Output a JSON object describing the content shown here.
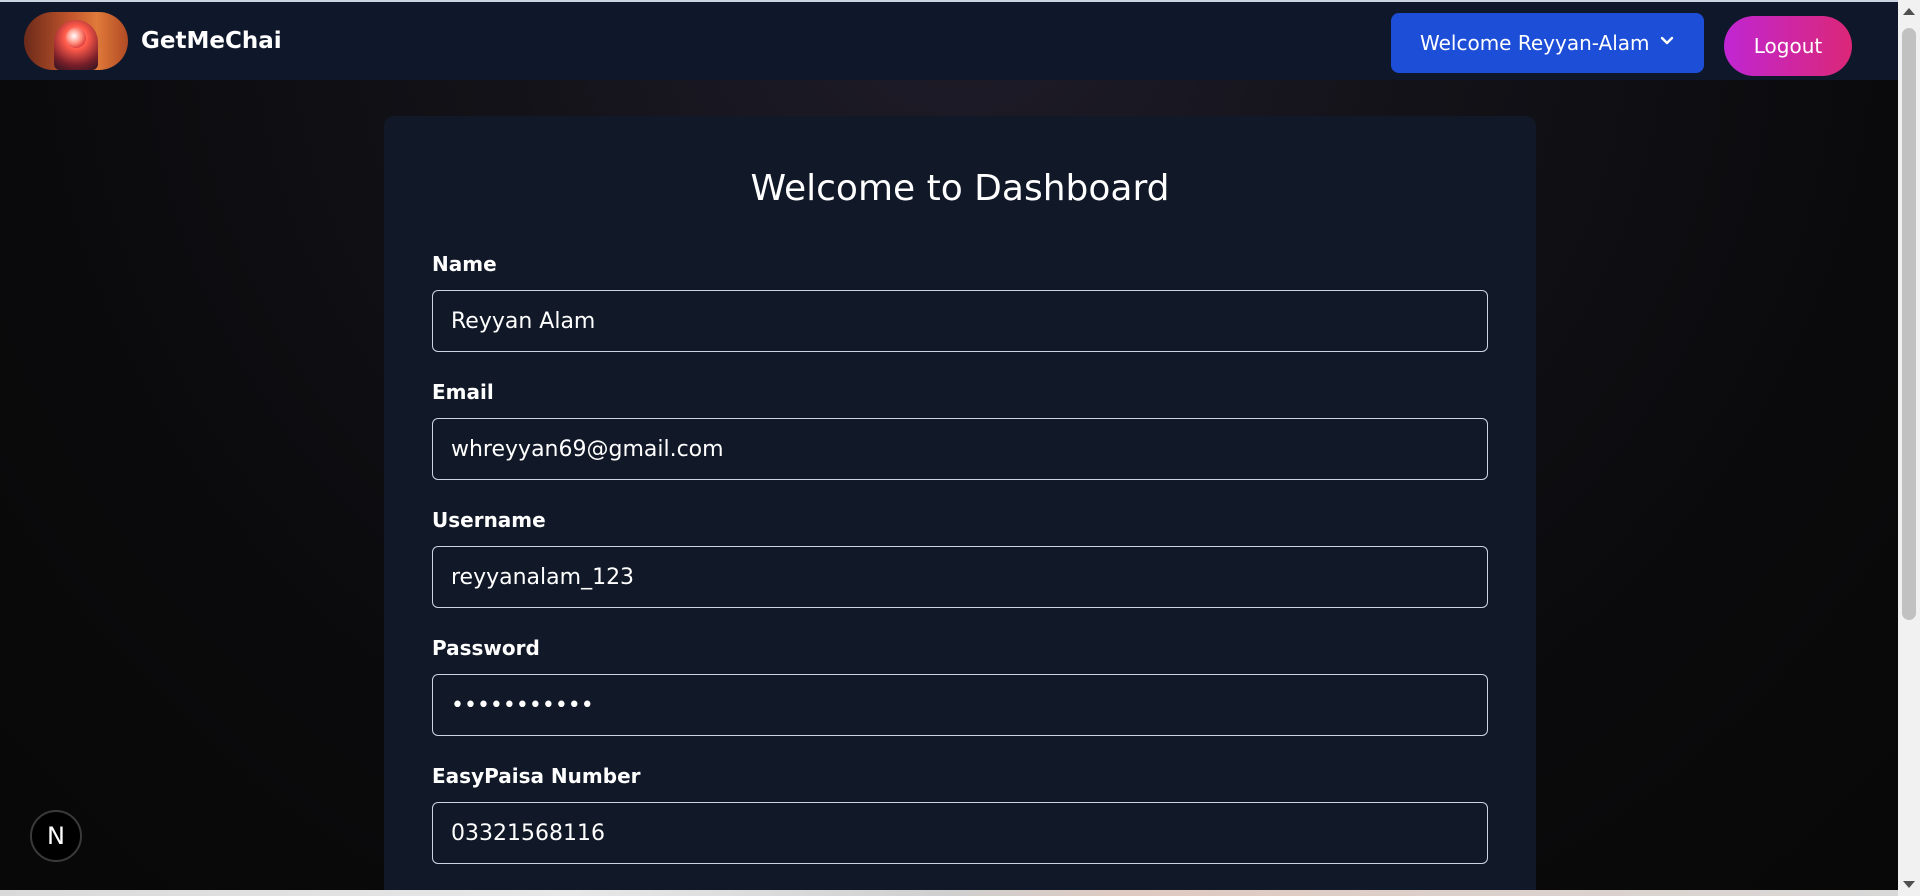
{
  "navbar": {
    "brand": "GetMeChai",
    "welcome_label": "Welcome Reyyan-Alam",
    "logout_label": "Logout"
  },
  "dashboard": {
    "title": "Welcome to Dashboard",
    "fields": [
      {
        "label": "Name",
        "value": "Reyyan Alam",
        "type": "text"
      },
      {
        "label": "Email",
        "value": "whreyyan69@gmail.com",
        "type": "text"
      },
      {
        "label": "Username",
        "value": "reyyanalam_123",
        "type": "text"
      },
      {
        "label": "Password",
        "value": "•••••••••••",
        "type": "password"
      },
      {
        "label": "EasyPaisa Number",
        "value": "03321568116",
        "type": "text"
      }
    ]
  },
  "dev_badge": {
    "label": "N"
  },
  "colors": {
    "navbar_bg": "#0f172a",
    "card_bg": "#111827",
    "welcome_button": "#1d4ed8",
    "logout_gradient_start": "#c026d3",
    "logout_gradient_end": "#db2777"
  },
  "icons": {
    "dropdown": "chevron-down-icon",
    "logo": "logo-icon"
  }
}
